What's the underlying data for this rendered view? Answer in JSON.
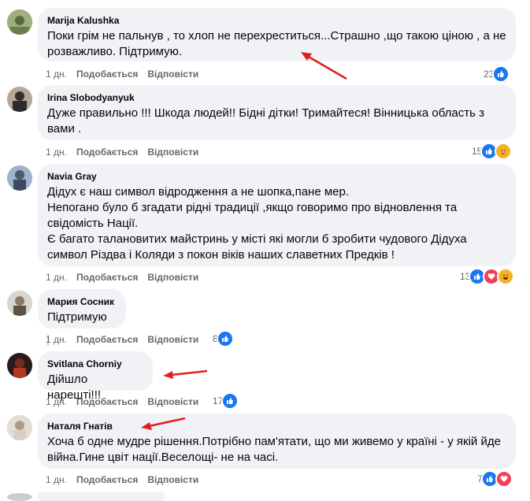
{
  "comments": [
    {
      "author": "Marija Kalushka",
      "text": "Поки грім не пальнув , то хлоп не перехреститься...Страшно ,що такою ціною , а не розважливо. Підтримую.",
      "time": "1 дн.",
      "like": "Подобається",
      "reply": "Відповісти",
      "count": "23",
      "reactions": [
        "like-icon"
      ]
    },
    {
      "author": "Irina Slobodyanyuk",
      "text": "Дуже правильно !!! Шкода людей!! Бідні дітки! Тримайтеся! Вінницька область з вами .",
      "time": "1 дн.",
      "like": "Подобається",
      "reply": "Відповісти",
      "count": "15",
      "reactions": [
        "like-icon",
        "care-icon"
      ]
    },
    {
      "author": "Navia Gray",
      "text": "Дідух є наш символ відродження а не шопка,пане мер.\nНепогано було б згадати рідні традиції ,якщо говоримо про відновлення та свідомість Нації.\nЄ багато талановитих майстринь у місті які могли б зробити чудового Дідуха символ Різдва і Коляди з покон віків наших славетних Предків !",
      "time": "1 дн.",
      "like": "Подобається",
      "reply": "Відповісти",
      "count": "13",
      "reactions": [
        "like-icon",
        "love-icon",
        "haha-icon"
      ]
    },
    {
      "author": "Мария Сосник",
      "text": "Підтримую",
      "time": "1 дн.",
      "like": "Подобається",
      "reply": "Відповісти",
      "count": "8",
      "reactions": [
        "like-icon"
      ]
    },
    {
      "author": "Svitlana Chorniy",
      "text": "Дійшло нарешті!!!",
      "time": "1 дн.",
      "like": "Подобається",
      "reply": "Відповісти",
      "count": "17",
      "reactions": [
        "like-icon"
      ]
    },
    {
      "author": "Наталя Гнатів",
      "text": "Хоча б одне мудре рішення.Потрібно пам'ятати, що ми живемо у країні - у якій йде війна.Гине цвіт нації.Веселощі- не на часі.",
      "time": "1 дн.",
      "like": "Подобається",
      "reply": "Відповісти",
      "count": "7",
      "reactions": [
        "like-icon",
        "love-icon"
      ]
    }
  ],
  "colors": {
    "bubble": "#f0f2f5",
    "meta": "#65676b",
    "like": "#1877f2",
    "love": "#f33e58",
    "care": "#f7b125",
    "arrow": "#e0201b"
  }
}
